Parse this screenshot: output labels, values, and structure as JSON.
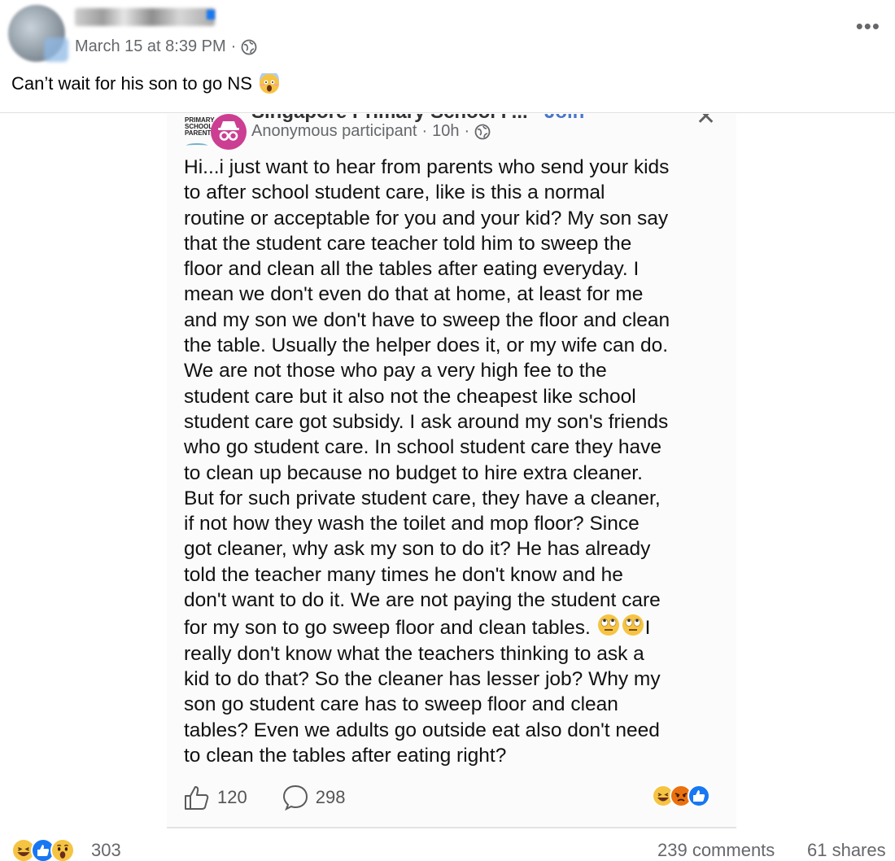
{
  "post": {
    "timestamp": "March 15 at 8:39 PM",
    "separator": "·",
    "caption": "Can’t wait for his son to go NS"
  },
  "shared_screenshot": {
    "group_title": "Singapore Primary School P...",
    "join_label": "Join",
    "logo_text": "PRIMARY\nSCHOOL\nPARENTS",
    "author": "Anonymous participant",
    "time": "10h",
    "separator": "·",
    "body_part1": "Hi...i just want to hear from parents who send your kids\nto after school student care, like is this a normal\nroutine or acceptable for you and your kid? My son say\nthat the student care teacher told him to sweep the\nfloor and clean all the tables after eating everyday. I\nmean we don't even do that at home, at least for me\nand my son we don't have to sweep the floor and clean\nthe table. Usually the helper does it, or my wife can do.\nWe are not those who pay a very high fee to the\nstudent care but it also not the cheapest like school\nstudent care got subsidy. I ask around my son's friends\nwho go student care. In school student care they have\nto clean up because no budget to hire extra cleaner.\nBut for such private student care, they have a cleaner,\nif not how they wash the toilet and mop floor? Since\ngot cleaner, why ask my son to do it? He has already\ntold the teacher many times he don't know and he\ndon't want to do it. We are not paying the student care\nfor my son to go sweep floor and clean tables. ",
    "body_part2": "I\nreally don't know what the teachers thinking to ask a\nkid to do that? So the cleaner has lesser job? Why my\nson go student care has to sweep floor and clean\ntables? Even we adults go outside eat also don't need\nto clean the tables after eating right?",
    "likes": "120",
    "comments": "298"
  },
  "footer": {
    "reaction_count": "303",
    "comments": "239 comments",
    "shares": "61 shares"
  },
  "icons": {
    "audience": "globe-icon",
    "menu": "more-options-icon",
    "caption_emoji": "face-screaming-icon",
    "inline_emoji": "eye-roll-icon",
    "like": "thumbs-up-icon",
    "comment": "speech-bubble-icon"
  }
}
